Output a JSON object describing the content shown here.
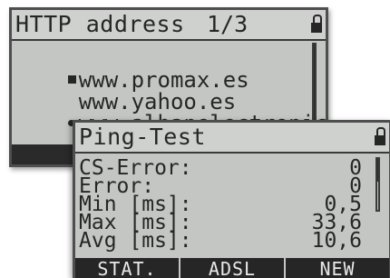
{
  "http_screen": {
    "title": "HTTP address",
    "page_indicator": "1/3",
    "lock_icon": "lock-icon",
    "urls": [
      {
        "marker": "square",
        "text": "www.promax.es"
      },
      {
        "marker": "none",
        "text": "www.yahoo.es"
      },
      {
        "marker": "dot",
        "text": "www.albanelectronic"
      }
    ]
  },
  "ping_screen": {
    "title": "Ping-Test",
    "lock_icon": "lock-icon",
    "rows": [
      {
        "label": "CS-Error:",
        "value": "0"
      },
      {
        "label": "Error:",
        "value": "0"
      },
      {
        "label": "Min [ms]:",
        "value": "0,5"
      },
      {
        "label": "Max [ms]:",
        "value": "33,6"
      },
      {
        "label": "Avg [ms]:",
        "value": "10,6"
      }
    ],
    "softkeys": [
      "STAT.",
      "ADSL",
      "NEW"
    ]
  },
  "colors": {
    "lcd_background": "#c4c6c4",
    "lcd_text": "#262626",
    "bezel": "#4e4e4e"
  }
}
